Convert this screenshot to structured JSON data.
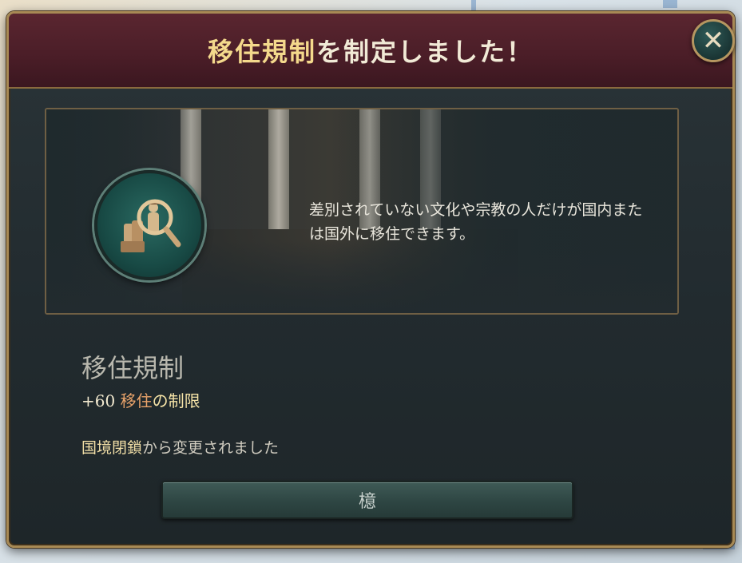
{
  "dialog": {
    "title_highlight": "移住規制",
    "title_rest": "を制定しました！",
    "close_symbol": "✕",
    "description": "差別されていない文化や宗教の人だけが国内または国外に移住できます。",
    "law_name": "移住規制",
    "effect": {
      "amount": "+60",
      "keyword1": "移住",
      "keyword2": "の制限"
    },
    "changed": {
      "previous_law": "国境閉鎖",
      "suffix": "から変更されました"
    },
    "ok_label": "檍"
  },
  "icons": {
    "law_icon": "magnifying-glass-immigrants-icon",
    "close_icon": "close-icon"
  },
  "colors": {
    "header_bg": "#4a1d27",
    "panel_bg": "#222b2f",
    "border_gold": "#a88a55",
    "highlight_yellow": "#f4d98c",
    "keyword_orange": "#e9a36a",
    "button_teal": "#2e4643"
  }
}
